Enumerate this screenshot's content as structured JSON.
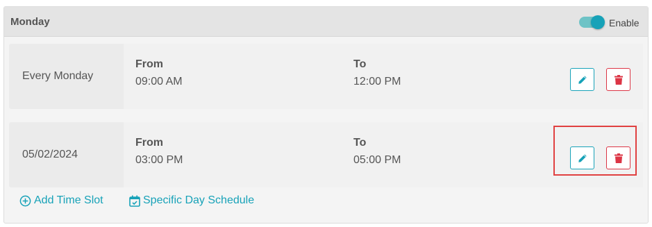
{
  "panel": {
    "title": "Monday",
    "toggle_label": "Enable",
    "toggle_on": true,
    "accent_color": "#17a2b8",
    "delete_color": "#dc3545"
  },
  "slots": [
    {
      "day": "Every Monday",
      "from_label": "From",
      "from_time": "09:00 AM",
      "to_label": "To",
      "to_time": "12:00 PM",
      "edit_icon": "pencil-icon",
      "delete_icon": "trash-icon"
    },
    {
      "day": "05/02/2024",
      "from_label": "From",
      "from_time": "03:00 PM",
      "to_label": "To",
      "to_time": "05:00 PM",
      "edit_icon": "pencil-icon",
      "delete_icon": "trash-icon"
    }
  ],
  "footer": {
    "add_slot_label": "Add Time Slot",
    "add_slot_icon": "plus-circle-icon",
    "specific_day_label": "Specific Day Schedule",
    "specific_day_icon": "calendar-check-icon"
  }
}
